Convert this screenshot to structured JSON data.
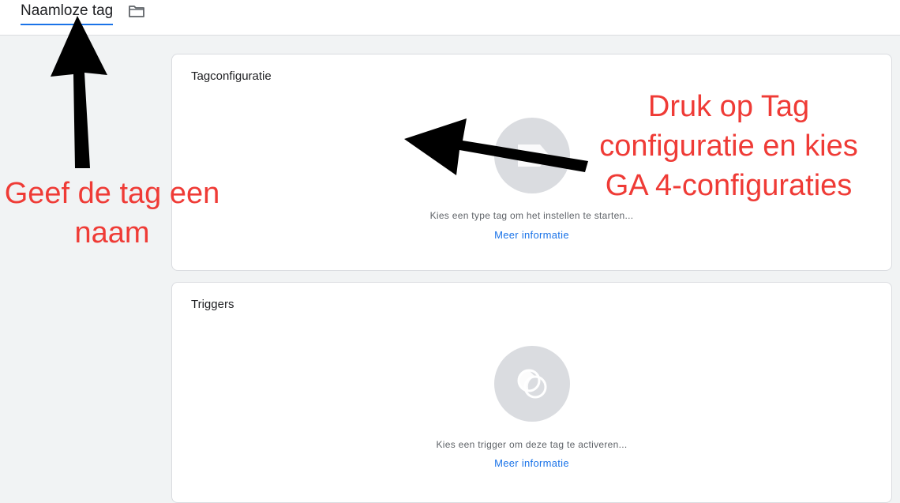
{
  "header": {
    "tag_name": "Naamloze tag",
    "folder_icon": "folder-icon"
  },
  "cards": {
    "tag_config": {
      "title": "Tagconfiguratie",
      "icon": "tag-icon",
      "hint": "Kies een type tag om het instellen te starten...",
      "link": "Meer informatie"
    },
    "triggers": {
      "title": "Triggers",
      "icon": "trigger-circles-icon",
      "hint": "Kies een trigger om deze tag te activeren...",
      "link": "Meer informatie"
    }
  },
  "annotations": {
    "left_lines": [
      "Geef de tag een",
      "naam"
    ],
    "right_lines": [
      "Druk op Tag",
      "configuratie en kies",
      "GA 4-configuraties"
    ],
    "color": "#ef3b36"
  },
  "colors": {
    "accent": "#1a73e8",
    "background": "#f1f3f4",
    "icon_circle": "#dadce0"
  }
}
